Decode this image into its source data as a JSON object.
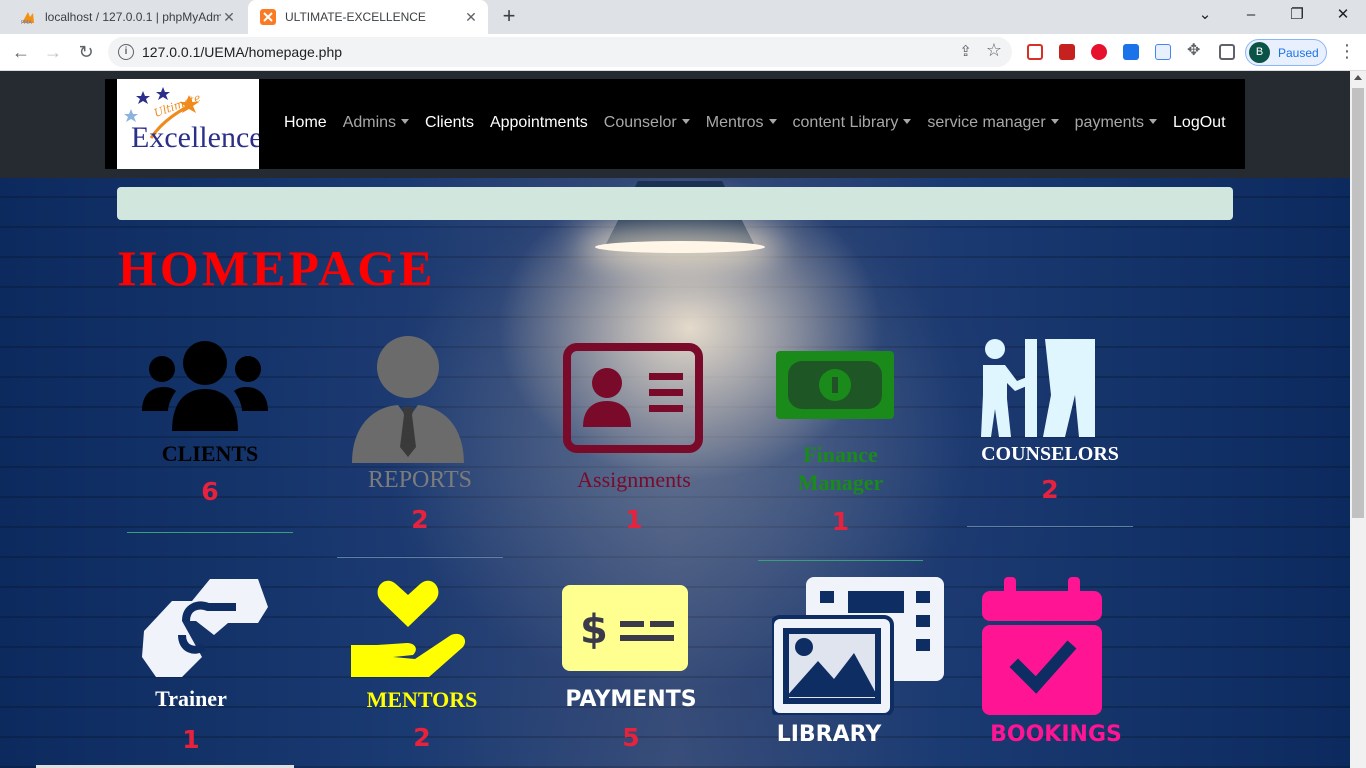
{
  "browser": {
    "tabs": [
      {
        "title": "localhost / 127.0.0.1 | phpMyAdmin",
        "active": false
      },
      {
        "title": "ULTIMATE-EXCELLENCE",
        "active": true
      }
    ],
    "url": "127.0.0.1/UEMA/homepage.php",
    "profile_initial": "B",
    "profile_status": "Paused"
  },
  "site": {
    "logo_word": "Excellence",
    "logo_script": "Ultimate",
    "nav": [
      {
        "label": "Home",
        "dropdown": false
      },
      {
        "label": "Admins",
        "dropdown": true
      },
      {
        "label": "Clients",
        "dropdown": false
      },
      {
        "label": "Appointments",
        "dropdown": false
      },
      {
        "label": "Counselor",
        "dropdown": true
      },
      {
        "label": "Mentros",
        "dropdown": true
      },
      {
        "label": "content Library",
        "dropdown": true
      },
      {
        "label": "service manager",
        "dropdown": true
      },
      {
        "label": "payments",
        "dropdown": true
      },
      {
        "label": "LogOut",
        "dropdown": false
      }
    ],
    "heading": "HOMEPAGE"
  },
  "cards": [
    {
      "label": "CLIENTS",
      "count": "6",
      "color": "#000000",
      "icon": "users-group-icon"
    },
    {
      "label": "REPORTS",
      "count": "2",
      "color": "#6b6b6b",
      "icon": "user-tie-icon"
    },
    {
      "label": "Assignments",
      "count": "1",
      "color": "#7a0a2a",
      "icon": "id-card-icon"
    },
    {
      "label": "Finance Manager",
      "count": "1",
      "color": "#1a8a1a",
      "icon": "money-bill-icon"
    },
    {
      "label": "COUNSELORS",
      "count": "2",
      "color": "#ffffff",
      "icon": "person-booth-icon"
    },
    {
      "label": "Trainer",
      "count": "1",
      "color": "#ffffff",
      "icon": "handshake-icon"
    },
    {
      "label": "MENTORS",
      "count": "2",
      "color": "#ffff00",
      "icon": "hand-holding-heart-icon"
    },
    {
      "label": "PAYMENTS",
      "count": "5",
      "color": "#ffffff",
      "icon": "money-check-dollar-icon"
    },
    {
      "label": "LIBRARY",
      "count": "",
      "color": "#ffffff",
      "icon": "photo-film-icon"
    },
    {
      "label": "BOOKINGS",
      "count": "",
      "color": "#ff1493",
      "icon": "calendar-check-icon"
    }
  ]
}
